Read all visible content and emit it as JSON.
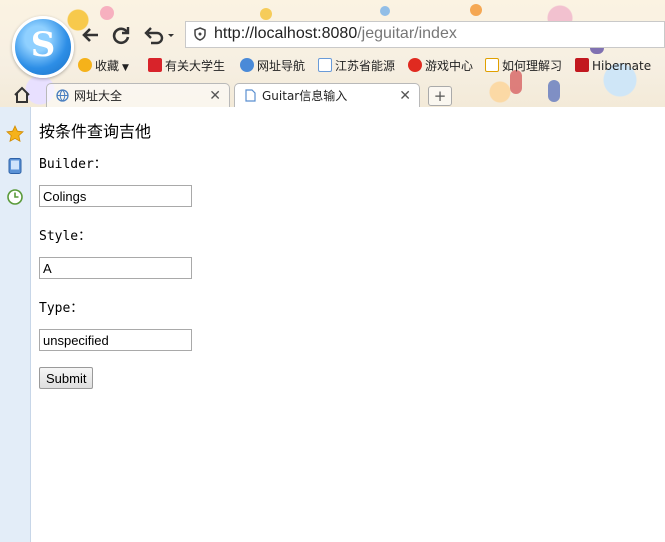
{
  "browser": {
    "url_host": "http://localhost:8080",
    "url_path": "/jeguitar/index",
    "bookmarks": [
      {
        "label": "收藏",
        "icon": "star-icon",
        "color": "#f5b21a"
      },
      {
        "label": "有关大学生",
        "icon": "bookmark-red-icon",
        "color": "#d8232a"
      },
      {
        "label": "网址导航",
        "icon": "globe-icon",
        "color": "#4a8ad8"
      },
      {
        "label": "江苏省能源",
        "icon": "page-icon",
        "color": "#6a9bd8"
      },
      {
        "label": "游戏中心",
        "icon": "game-icon",
        "color": "#e02a20"
      },
      {
        "label": "如何理解习",
        "icon": "100-icon",
        "color": "#e0a000"
      },
      {
        "label": "Hibernate",
        "icon": "c-icon",
        "color": "#c2181f"
      }
    ],
    "tabs": [
      {
        "label": "网址大全",
        "active": false
      },
      {
        "label": "Guitar信息输入",
        "active": true
      }
    ],
    "close_glyph": "✕",
    "newtab_glyph": "+"
  },
  "form": {
    "heading": "按条件查询吉他",
    "builder_label": "Builder：",
    "builder_value": "Colings",
    "style_label": "Style：",
    "style_value": "A",
    "type_label": "Type：",
    "type_value": "unspecified",
    "submit_label": "Submit"
  }
}
